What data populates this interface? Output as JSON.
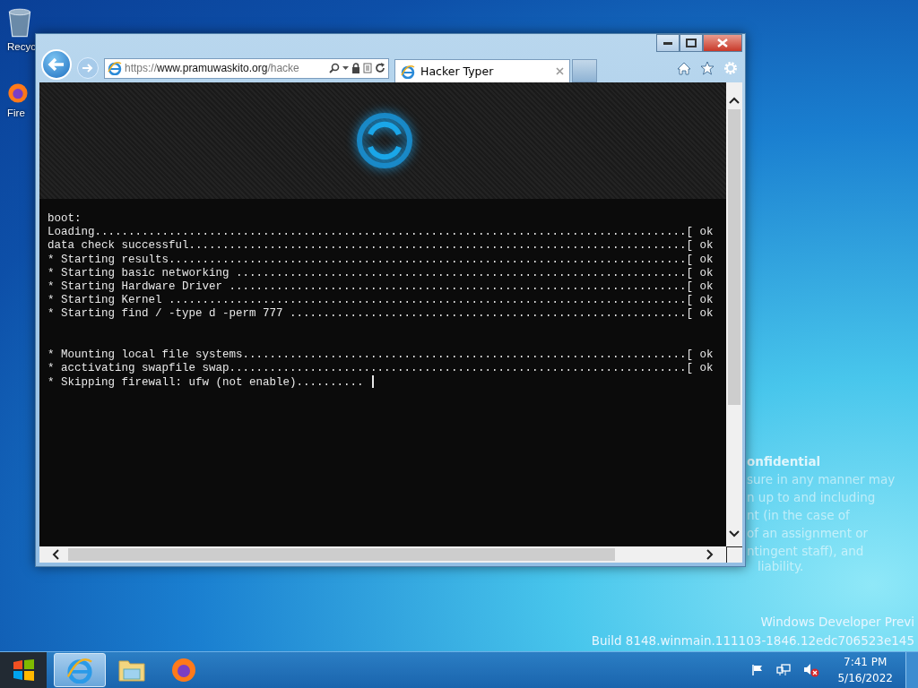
{
  "desktop_icons": [
    {
      "label": "Recyc",
      "kind": "bin"
    },
    {
      "label": "Fire",
      "kind": "firefox"
    }
  ],
  "wallpaper_notice": {
    "title": "onfidential",
    "lines": [
      "sure in any manner may",
      "n up to and including",
      "nt (in the case of",
      "of an assignment or",
      "ntingent staff), and"
    ],
    "last_line": "liability."
  },
  "build_info": {
    "edition": "Windows Developer Previ",
    "build": "Build 8148.winmain.111103-1846.12edc706523e145"
  },
  "browser": {
    "address": {
      "scheme": "https://",
      "host": "www.pramuwaskito.org",
      "path": "/hacke"
    },
    "tab": {
      "title": "Hacker Typer",
      "selected": true
    },
    "terminal": {
      "blocks": [
        [
          "boot:",
          "Loading........................................................................................[ ok",
          "data check successful..........................................................................[ ok",
          "* Starting results.............................................................................[ ok",
          "* Starting basic networking ...................................................................[ ok",
          "* Starting Hardware Driver ....................................................................[ ok",
          "* Starting Kernel .............................................................................[ ok",
          "* Starting find / -type d -perm 777 ...........................................................[ ok"
        ],
        [
          "* Mounting local file systems..................................................................[ ok",
          "* acctivating swapfile swap....................................................................[ ok",
          "* Skipping firewall: ufw (not enable).........."
        ]
      ],
      "cursor": true
    }
  },
  "taskbar": {
    "apps": [
      {
        "kind": "ie",
        "selected": true
      },
      {
        "kind": "explorer",
        "selected": false
      },
      {
        "kind": "firefox",
        "selected": false
      }
    ],
    "tray": {
      "volume_muted": true,
      "time": "7:41 PM",
      "date": "5/16/2022"
    }
  }
}
